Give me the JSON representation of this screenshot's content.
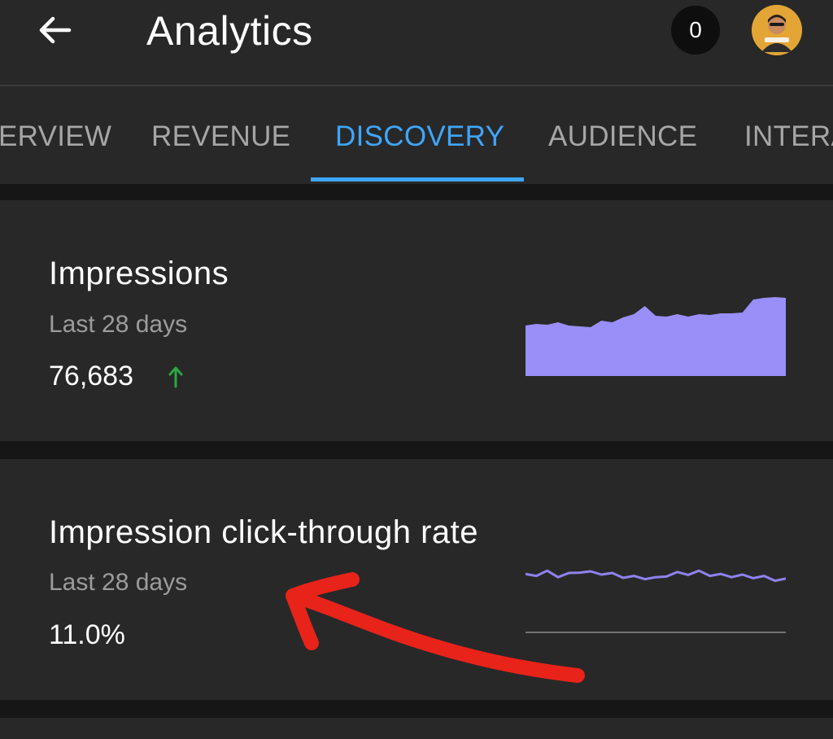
{
  "header": {
    "title": "Analytics",
    "notification_count": "0",
    "back_icon": "arrow-left-icon",
    "avatar_icon": "user-avatar"
  },
  "tabs": [
    {
      "label": "ERVIEW",
      "active": false
    },
    {
      "label": "REVENUE",
      "active": false
    },
    {
      "label": "DISCOVERY",
      "active": true
    },
    {
      "label": "AUDIENCE",
      "active": false
    },
    {
      "label": "INTERA",
      "active": false
    }
  ],
  "colors": {
    "accent": "#3ea6ff",
    "spark_fill": "#9a8ff8",
    "spark_line": "#8f82f0",
    "trend_up": "#2ba640",
    "annotation": "#e8231a"
  },
  "cards": {
    "impressions": {
      "title": "Impressions",
      "period": "Last 28 days",
      "value": "76,683",
      "trend": "up",
      "sparkline": [
        0.62,
        0.64,
        0.63,
        0.66,
        0.62,
        0.61,
        0.6,
        0.68,
        0.66,
        0.72,
        0.76,
        0.86,
        0.74,
        0.73,
        0.76,
        0.73,
        0.76,
        0.75,
        0.77,
        0.77,
        0.78,
        0.94,
        0.96,
        0.97,
        0.96
      ]
    },
    "ctr": {
      "title": "Impression click-through rate",
      "period": "Last 28 days",
      "value": "11.0%",
      "sparkline": [
        0.52,
        0.46,
        0.62,
        0.42,
        0.55,
        0.56,
        0.6,
        0.5,
        0.55,
        0.4,
        0.46,
        0.36,
        0.42,
        0.44,
        0.58,
        0.49,
        0.62,
        0.46,
        0.52,
        0.42,
        0.5,
        0.39,
        0.46,
        0.31,
        0.38
      ]
    }
  }
}
